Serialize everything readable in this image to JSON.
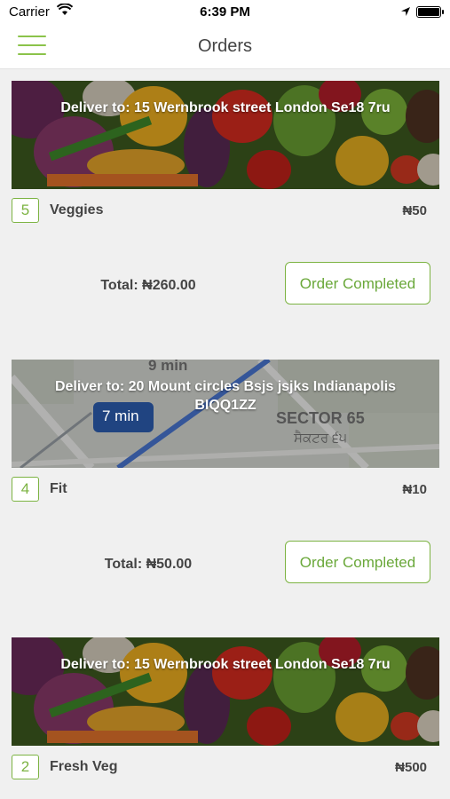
{
  "status_bar": {
    "carrier": "Carrier",
    "time": "6:39 PM"
  },
  "nav": {
    "title": "Orders"
  },
  "currency": "₦",
  "orders": [
    {
      "image": "vegetables",
      "address_line": "Deliver to:  15 Wernbrook street London Se18 7ru",
      "quantity": "5",
      "item": "Veggies",
      "price": "₦50",
      "total": "Total: ₦260.00",
      "action_label": "Order Completed"
    },
    {
      "image": "map",
      "address_line": "Deliver to:  20 Mount circles Bsjs jsjks Indianapolis BIQQ1ZZ",
      "quantity": "4",
      "item": "Fit",
      "price": "₦10",
      "total": "Total: ₦50.00",
      "action_label": "Order Completed",
      "map_labels": {
        "route_top": "9 min",
        "route_badge": "7 min",
        "sector": "SECTOR 65",
        "sector_local": "ਸੈਕਟਰ ੬੫"
      }
    },
    {
      "image": "vegetables",
      "address_line": "Deliver to:  15 Wernbrook street London Se18 7ru",
      "quantity": "2",
      "item": "Fresh Veg",
      "price": "₦500"
    }
  ],
  "colors": {
    "accent": "#7cb342",
    "background": "#f0f0f0"
  }
}
